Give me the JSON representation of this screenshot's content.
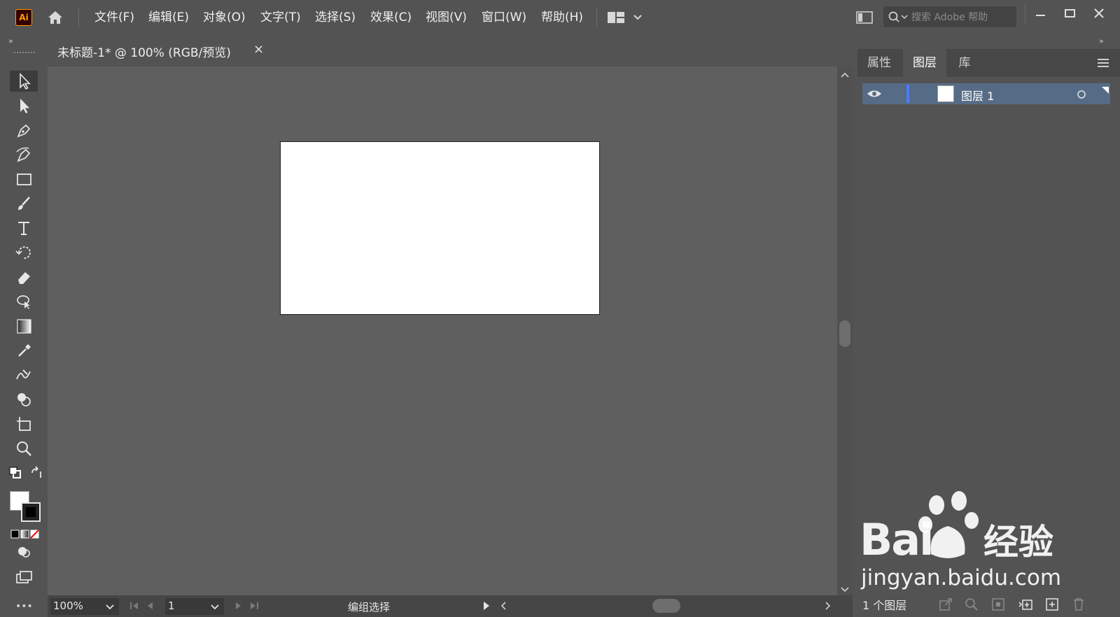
{
  "app": {
    "logo_text": "Ai"
  },
  "menu": {
    "items": [
      "文件(F)",
      "编辑(E)",
      "对象(O)",
      "文字(T)",
      "选择(S)",
      "效果(C)",
      "视图(V)",
      "窗口(W)",
      "帮助(H)"
    ]
  },
  "search": {
    "placeholder": "搜索 Adobe 帮助"
  },
  "document": {
    "tab_title": "未标题-1* @ 100% (RGB/预览)",
    "close_glyph": "×"
  },
  "toolbar": {
    "tools": [
      "selection-tool",
      "direct-selection-tool",
      "pen-tool",
      "curvature-tool",
      "rectangle-tool",
      "paintbrush-tool",
      "type-tool",
      "rotate-tool",
      "eraser-tool",
      "lasso-tool",
      "gradient-tool",
      "eyedropper-tool",
      "blend-tool",
      "shape-builder-tool",
      "artboard-tool",
      "zoom-tool"
    ],
    "fill_color": "#ffffff",
    "stroke_color": "#000000"
  },
  "status": {
    "zoom": "100%",
    "page": "1",
    "mode": "编组选择"
  },
  "panel": {
    "tabs": [
      "属性",
      "图层",
      "库"
    ],
    "active_tab": "图层",
    "layers": [
      {
        "name": "图层 1",
        "visible": true,
        "color": "#4a7bff"
      }
    ],
    "layer_count_label": "1 个图层"
  },
  "watermark": {
    "brand": "Bai",
    "suffix": "经验",
    "url": "jingyan.baidu.com"
  },
  "colors": {
    "accent": "#ff9a00",
    "selected_layer": "#566c86",
    "artboard": "#ffffff",
    "canvas": "#5f5f5f"
  }
}
